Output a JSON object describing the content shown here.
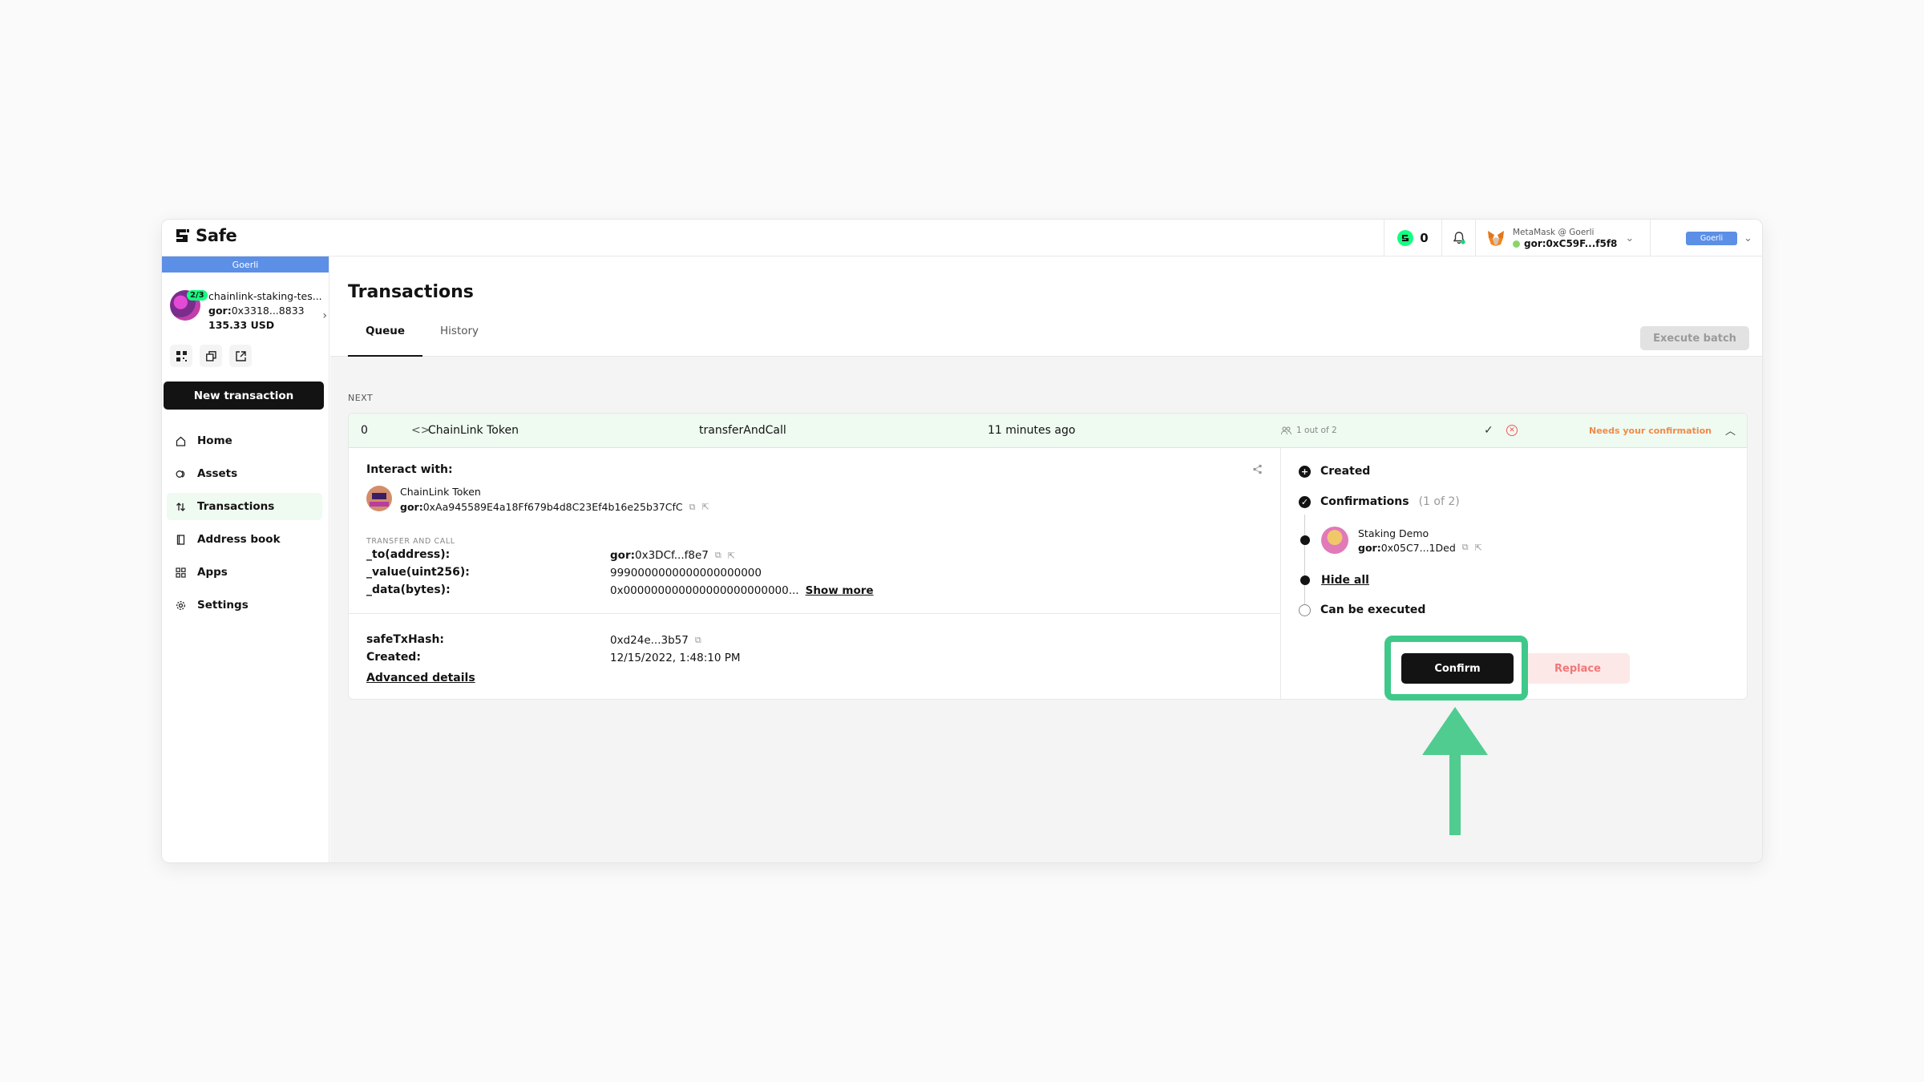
{
  "app": {
    "name": "Safe"
  },
  "header": {
    "safe_tokens_count": "0",
    "wallet_label": "MetaMask @ Goerli",
    "wallet_address": "gor:0xC59F...f5f8",
    "network": "Goerli"
  },
  "sidebar": {
    "network_banner": "Goerli",
    "safe_name": "chainlink-staking-tes...",
    "safe_threshold": "2/3",
    "safe_address_prefix": "gor:",
    "safe_address": "0x3318...8833",
    "safe_balance": "135.33 USD",
    "new_tx_label": "New transaction",
    "items": [
      {
        "label": "Home",
        "icon": "home-icon",
        "active": false
      },
      {
        "label": "Assets",
        "icon": "assets-icon",
        "active": false
      },
      {
        "label": "Transactions",
        "icon": "transactions-icon",
        "active": true
      },
      {
        "label": "Address book",
        "icon": "address-book-icon",
        "active": false
      },
      {
        "label": "Apps",
        "icon": "apps-icon",
        "active": false
      },
      {
        "label": "Settings",
        "icon": "settings-icon",
        "active": false
      }
    ]
  },
  "main": {
    "title": "Transactions",
    "tabs": [
      {
        "label": "Queue",
        "active": true
      },
      {
        "label": "History",
        "active": false
      }
    ],
    "execute_batch_label": "Execute batch",
    "section_label": "NEXT",
    "tx": {
      "nonce": "0",
      "token": "ChainLink Token",
      "method": "transferAndCall",
      "time": "11 minutes ago",
      "confirmations": "1 out of 2",
      "status": "Needs your confirmation",
      "interact_title": "Interact with:",
      "contract_name": "ChainLink Token",
      "contract_address_prefix": "gor:",
      "contract_address": "0xAa945589E4a18Ff679b4d8C23Ef4b16e25b37CfC",
      "method_label": "TRANSFER AND CALL",
      "params": [
        {
          "name": "_to(address):",
          "prefix": "gor:",
          "value": "0x3DCf...f8e7"
        },
        {
          "name": "_value(uint256):",
          "value": "9990000000000000000000"
        },
        {
          "name": "_data(bytes):",
          "value": "0x000000000000000000000000...",
          "more": "Show more"
        }
      ],
      "safe_tx_hash_label": "safeTxHash:",
      "safe_tx_hash": "0xd24e...3b57",
      "created_label": "Created:",
      "created": "12/15/2022, 1:48:10 PM",
      "advanced_label": "Advanced details",
      "steps": {
        "created": "Created",
        "confirmations": "Confirmations",
        "confirmations_count": "(1 of 2)",
        "signer_name": "Staking Demo",
        "signer_prefix": "gor:",
        "signer_address": "0x05C7...1Ded",
        "hide_all": "Hide all",
        "can_execute": "Can be executed"
      },
      "confirm_label": "Confirm",
      "replace_label": "Replace"
    }
  },
  "annotation": {
    "highlight_color": "#3ec98a"
  }
}
